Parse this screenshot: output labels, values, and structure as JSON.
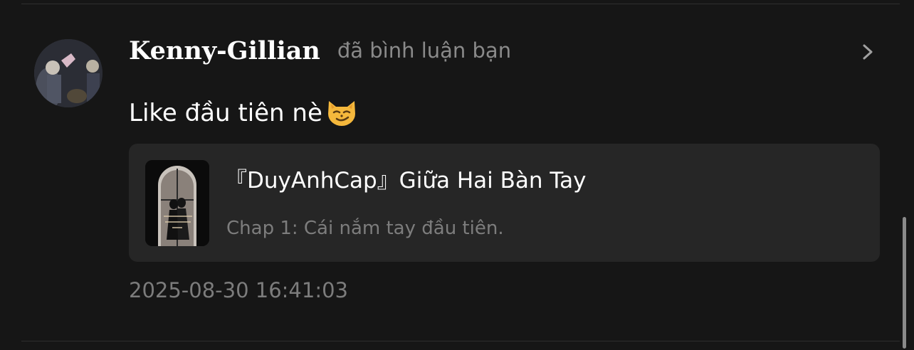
{
  "notification": {
    "username": "Kenny-Gillian",
    "action_text": "đã bình luận bạn",
    "comment_text": "Like đầu tiên nè",
    "timestamp": "2025-08-30 16:41:03"
  },
  "story_card": {
    "title": "『DuyAnhCap』Giữa Hai Bàn Tay",
    "chapter": "Chap 1: Cái nắm tay đầu tiên."
  },
  "icons": {
    "chevron": "chevron-right-icon",
    "emoji": "smirking-cat-emoji"
  },
  "colors": {
    "background": "#161616",
    "card_background": "#262626",
    "primary_text": "#ffffff",
    "secondary_text": "#8a8a8a"
  }
}
